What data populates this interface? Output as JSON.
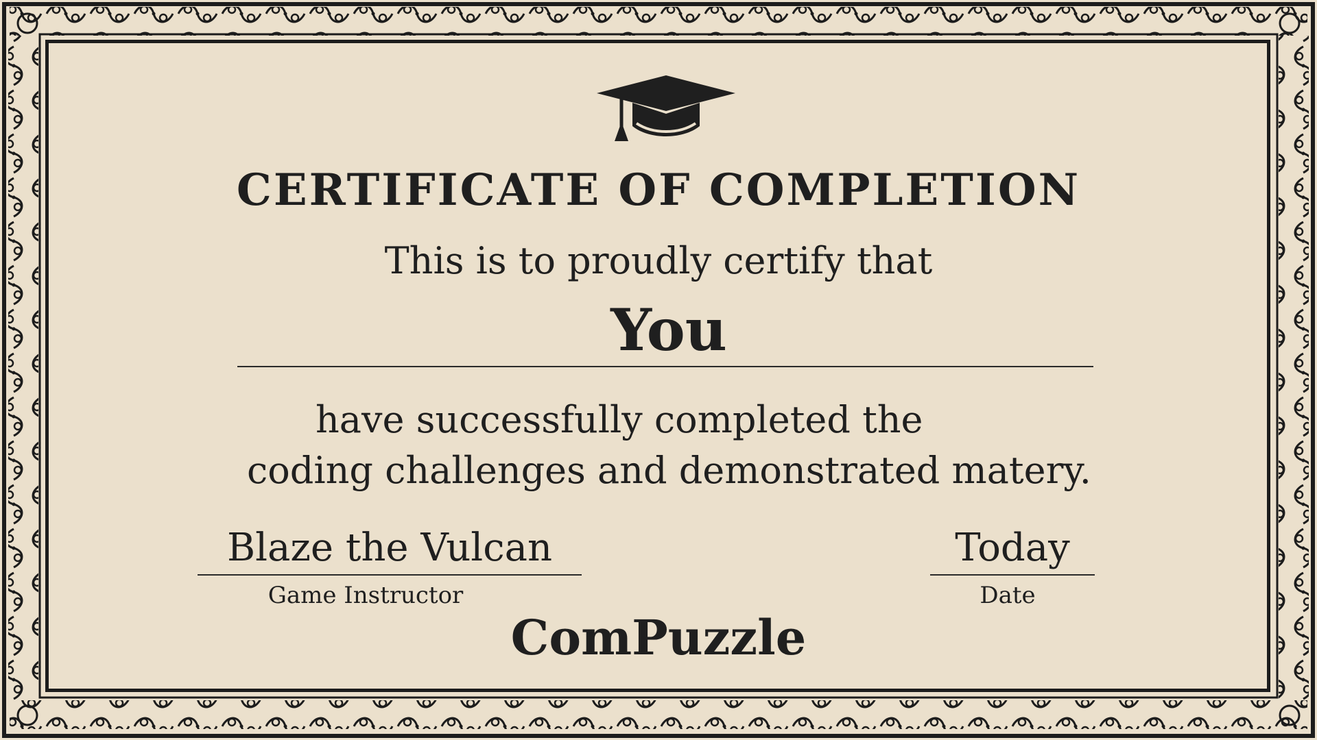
{
  "certificate": {
    "title": "CERTIFICATE OF COMPLETION",
    "certify_line": "This is to proudly certify that",
    "recipient": "You",
    "completion_line_1": "have successfully completed the",
    "completion_line_2": "coding challenges and demonstrated matery.",
    "instructor_name": "Blaze the Vulcan",
    "instructor_role": "Game Instructor",
    "date_value": "Today",
    "date_label": "Date",
    "brand": "ComPuzzle"
  },
  "icons": {
    "emblem": "graduation-cap-icon",
    "border": "ornamental-border"
  },
  "colors": {
    "paper": "#ebe0cc",
    "ink": "#1f1f1f",
    "border": "#1c1c1c"
  }
}
